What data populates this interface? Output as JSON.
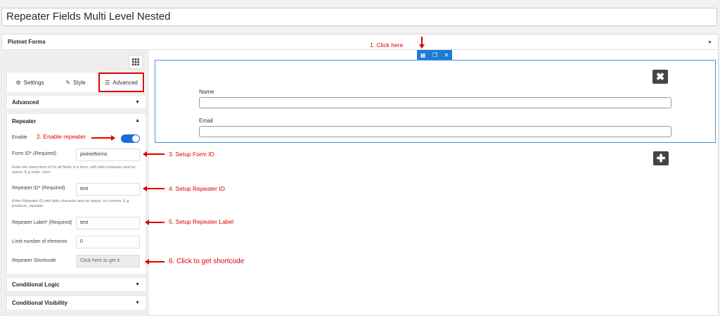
{
  "page_title": "Repeater Fields Multi Level Nested",
  "panel": {
    "title": "Piotnet Forms"
  },
  "tabs": [
    {
      "label": "Settings"
    },
    {
      "label": "Style"
    },
    {
      "label": "Advanced"
    }
  ],
  "sections": {
    "advanced": "Advanced",
    "repeater": "Repeater",
    "conditional_logic": "Conditional Logic",
    "conditional_visibility": "Conditional Visibility"
  },
  "fields": {
    "enable_label": "Enable",
    "form_id_label": "Form ID* (Required)",
    "form_id_value": "piotnetforms",
    "form_id_help": "Enter the same form id for all fields in a form, with latin character and no space. E.g order_form",
    "repeater_id_label": "Repeater ID* (Required)",
    "repeater_id_value": "test",
    "repeater_id_help": "Enter Repeater ID with latin character and no space, no comma. E.g products_repeater",
    "repeater_label_label": "Repeater Label* (Required)",
    "repeater_label_value": "test",
    "limit_label": "Limit number of elements",
    "limit_value": "0",
    "shortcode_label": "Repeater Shortcode",
    "shortcode_value": "Click here to get it"
  },
  "form": {
    "name_label": "Name",
    "email_label": "Email"
  },
  "annotations": {
    "a1": "1. Click here",
    "a2": "2. Enable repeater",
    "a3": "3. Setup Form ID",
    "a4": "4. Setup Repeater ID",
    "a5": "5. Setup Repeater Label",
    "a6": "6. Click to get shortcode"
  },
  "colors": {
    "accent": "#1e7bd6",
    "annotation": "#e00000"
  }
}
